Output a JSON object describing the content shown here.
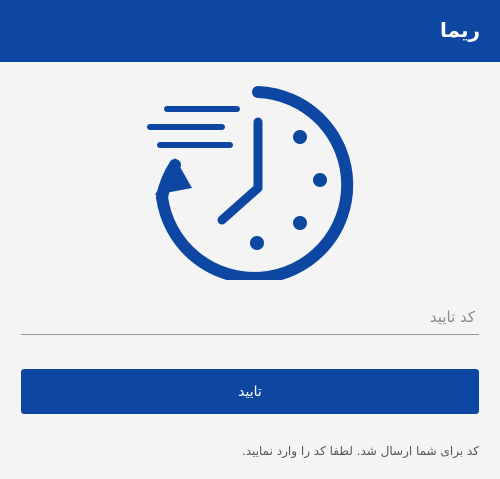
{
  "appbar": {
    "title": "ریما"
  },
  "hero": {
    "icon": "clock-history-icon",
    "accent": "#0d47a1"
  },
  "form": {
    "code_placeholder": "کد تایید",
    "code_value": "",
    "confirm_label": "تایید"
  },
  "hint": "کد برای شما ارسال شد. لطفا کد را وارد نمایید.",
  "colors": {
    "primary": "#0d47a1",
    "background": "#f4f4f4"
  }
}
